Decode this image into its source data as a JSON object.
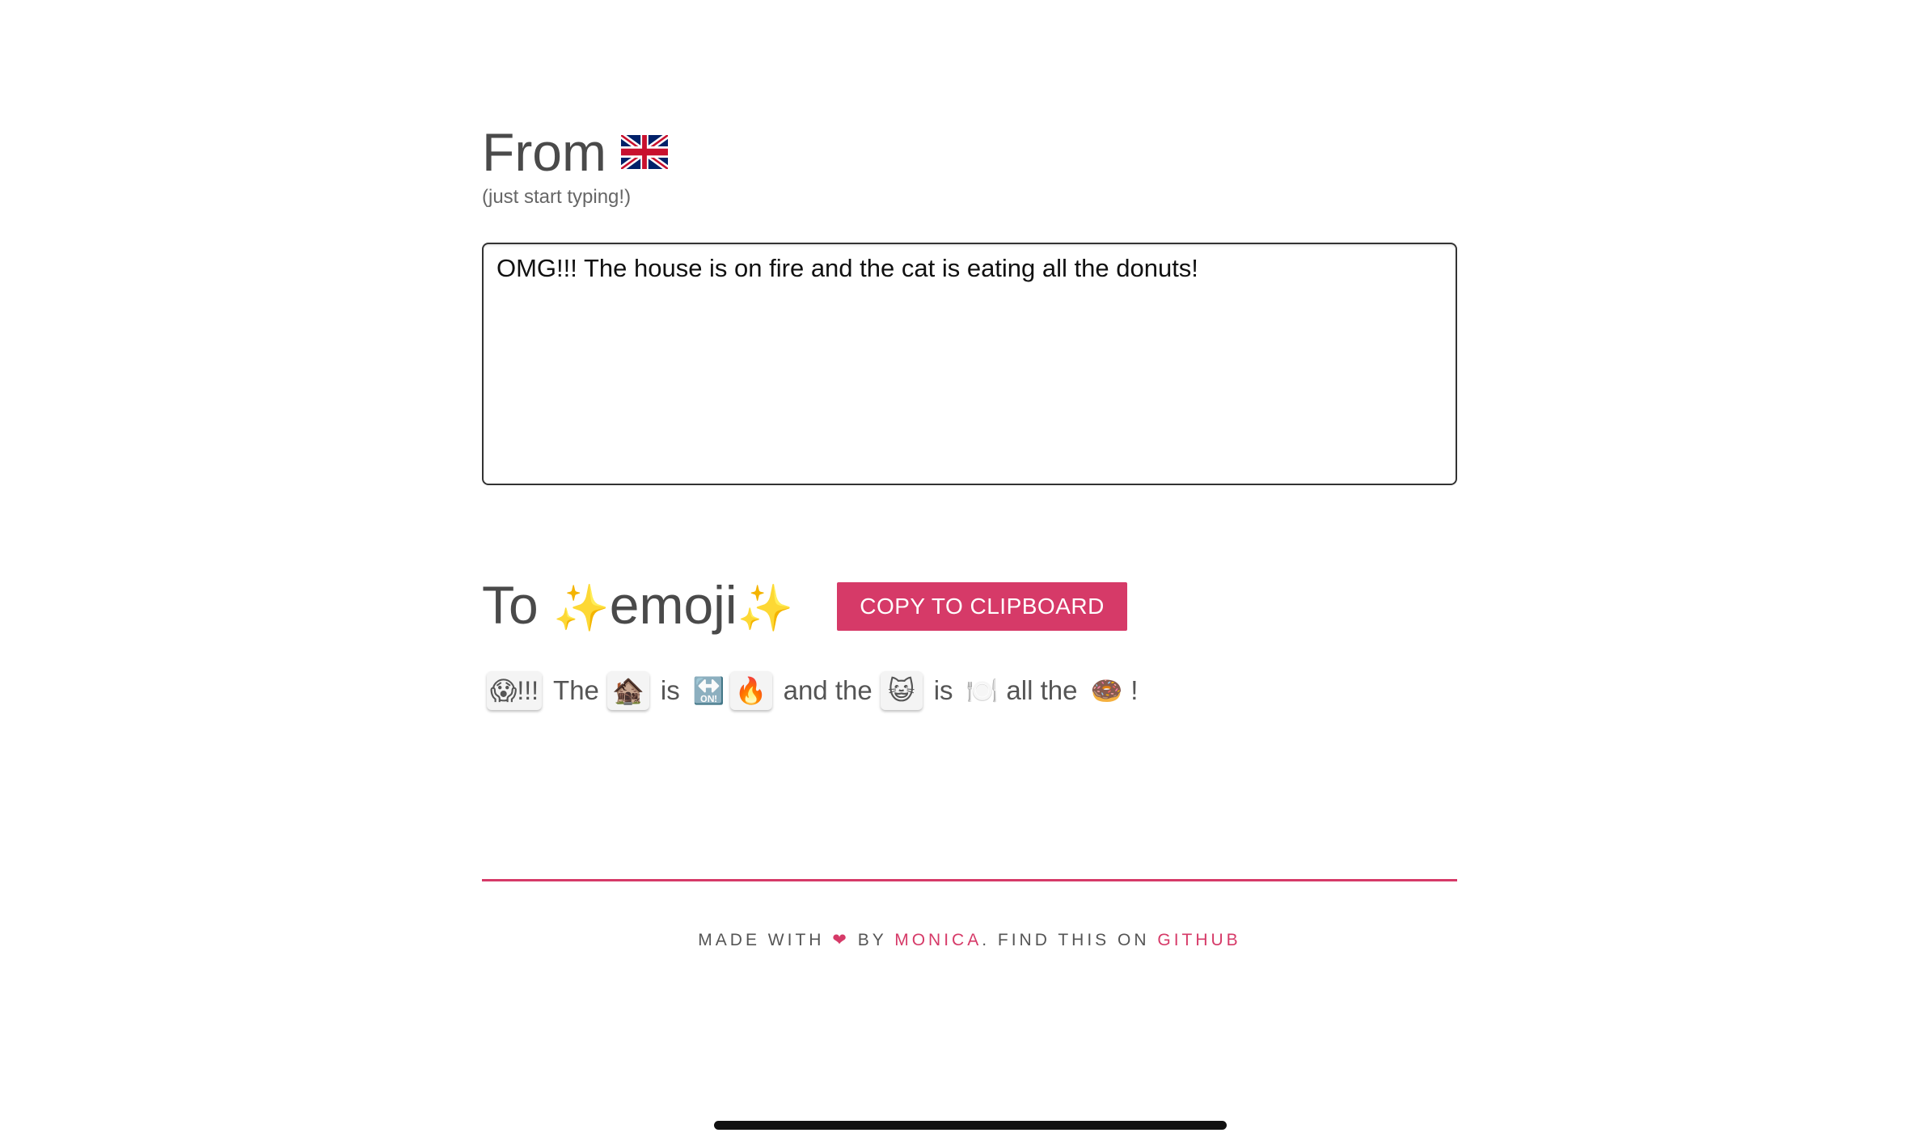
{
  "from": {
    "title": "From",
    "flag_icon": "uk-flag-icon",
    "hint": "(just start typing!)",
    "input_value": "OMG!!! The house is on fire and the cat is eating all the donuts!"
  },
  "to": {
    "title_prefix": "To ",
    "sparkle": "✨",
    "title_word": "emoji",
    "copy_label": "COPY TO CLIPBOARD"
  },
  "output": {
    "tokens": [
      {
        "kind": "chip",
        "text": "😱!!!"
      },
      {
        "kind": "word",
        "text": "The"
      },
      {
        "kind": "chip",
        "text": "🏚️"
      },
      {
        "kind": "word",
        "text": "is"
      },
      {
        "kind": "plain",
        "text": "🔛"
      },
      {
        "kind": "chip",
        "text": "🔥"
      },
      {
        "kind": "word",
        "text": "and the"
      },
      {
        "kind": "chip",
        "text": "😺"
      },
      {
        "kind": "word",
        "text": "is"
      },
      {
        "kind": "plain",
        "text": "🍽️"
      },
      {
        "kind": "word",
        "text": "all the"
      },
      {
        "kind": "plain",
        "text": "🍩"
      },
      {
        "kind": "word",
        "text": "!"
      }
    ]
  },
  "footer": {
    "made_with": "Made with",
    "heart": "❤",
    "by": "by",
    "author": "Monica",
    "find": ". Find this on",
    "github": "GitHub"
  },
  "colors": {
    "accent": "#d63a68",
    "text": "#555555"
  }
}
